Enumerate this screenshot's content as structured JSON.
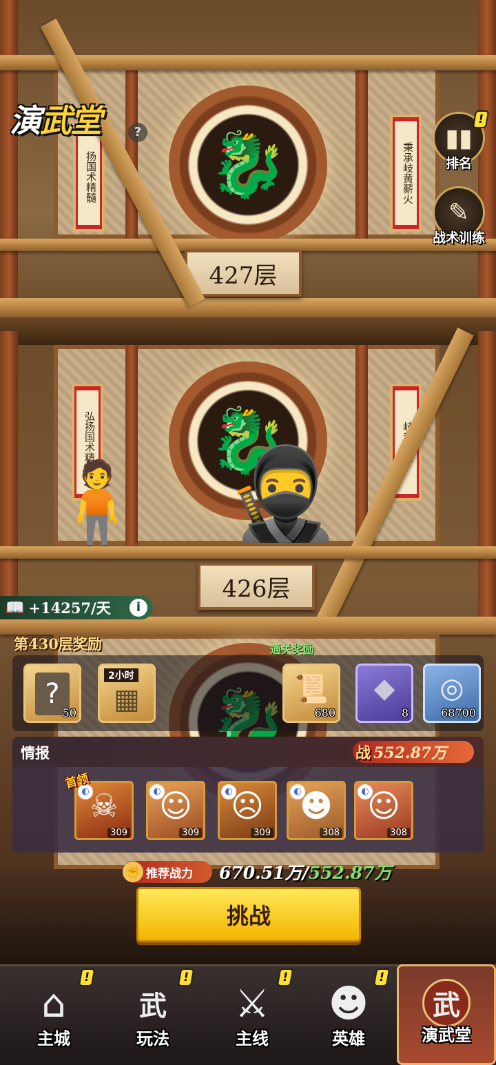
{
  "game_title": {
    "part1": "演",
    "part2": "武堂"
  },
  "help_icon": "?",
  "side_buttons": {
    "ranking": {
      "label": "排名",
      "alert": "!"
    },
    "tactics": {
      "label": "战术训练"
    }
  },
  "floors": [
    {
      "label": "427层",
      "scroll_left": "扬国术精髓",
      "scroll_right": "秉承岐黄薪火"
    },
    {
      "label": "426层",
      "scroll_left": "弘扬国术精髓",
      "scroll_right": "岐黄薪火"
    }
  ],
  "income": {
    "value": "+14257/天",
    "info": "i"
  },
  "rewards": {
    "title": "第430层奖励",
    "clear_title": "通关奖励",
    "items": [
      {
        "name": "mystery-card",
        "glyph": "?",
        "qty": "50",
        "tag": ""
      },
      {
        "name": "idle-chest",
        "glyph": "▦",
        "qty": "",
        "tag": "2小时"
      },
      {
        "name": "scroll",
        "glyph": "📜",
        "qty": "680",
        "tag": ""
      },
      {
        "name": "crystal",
        "glyph": "◆",
        "qty": "8",
        "tag": ""
      },
      {
        "name": "silver-coin",
        "glyph": "◎",
        "qty": "68700",
        "tag": ""
      }
    ]
  },
  "intel": {
    "title": "情报",
    "power_label": "战",
    "power_value": "552.87万",
    "boss_badge": "首领",
    "heroes": [
      {
        "level": "309",
        "face": "☠"
      },
      {
        "level": "309",
        "face": "☺"
      },
      {
        "level": "309",
        "face": "☹"
      },
      {
        "level": "308",
        "face": "☻"
      },
      {
        "level": "308",
        "face": "☺"
      }
    ]
  },
  "recommended": {
    "label": "推荐战力",
    "recommended_value": "670.51万",
    "separator": "/",
    "current_value": "552.87万"
  },
  "challenge_button": "挑战",
  "nav": [
    {
      "label": "主城",
      "icon": "⌂",
      "alert": "!"
    },
    {
      "label": "玩法",
      "icon": "武",
      "alert": "!"
    },
    {
      "label": "主线",
      "icon": "⚔",
      "alert": "!"
    },
    {
      "label": "英雄",
      "icon": "☻",
      "alert": "!"
    },
    {
      "label": "演武堂",
      "icon": "武",
      "alert": ""
    }
  ],
  "colors": {
    "accent_yellow": "#ffd23a",
    "green_value": "#7de36a",
    "power_red": "#b0281e"
  }
}
